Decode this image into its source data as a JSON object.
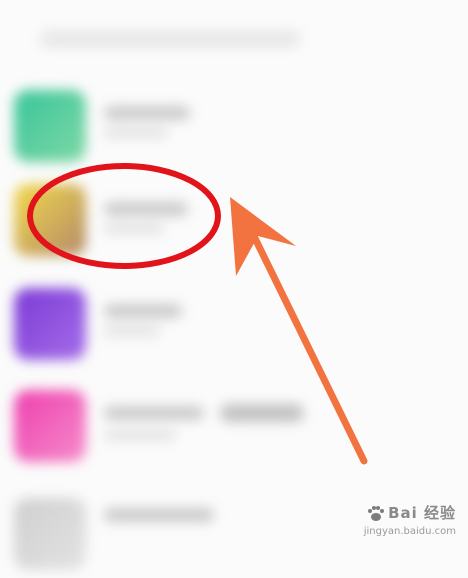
{
  "screen": {
    "description_hidden": false,
    "rows": [
      {
        "thumb_color": "#39c59a",
        "thumb_color2": "#7fd8a6"
      },
      {
        "thumb_color": "#f1d94a",
        "thumb_color2": "#b48a6a"
      },
      {
        "thumb_color": "#7b3ad6",
        "thumb_color2": "#a56de8"
      },
      {
        "thumb_color": "#ee3fae",
        "thumb_color2": "#f58ccb"
      },
      {
        "thumb_color": "#cfcfcf",
        "thumb_color2": "#e3e3e3"
      }
    ]
  },
  "annotation": {
    "circle_color": "#e0141a",
    "arrow_color": "#f27340"
  },
  "watermark": {
    "brand": "Bai  经验",
    "url": "jingyan.baidu.com"
  }
}
